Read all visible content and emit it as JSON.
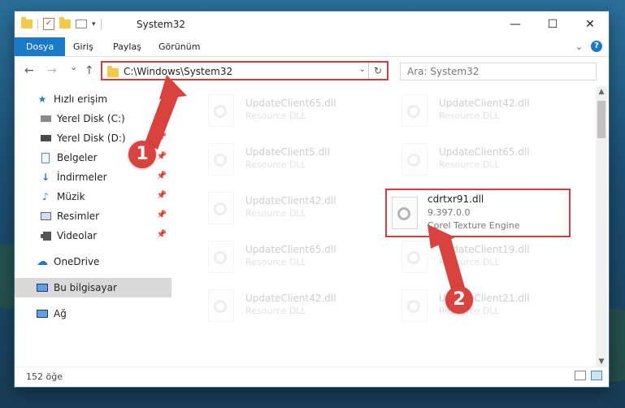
{
  "window": {
    "title": "System32",
    "controls": {
      "minimize": "—",
      "maximize": "☐",
      "close": "✕"
    }
  },
  "ribbon": {
    "tabs": [
      {
        "label": "Dosya",
        "active": true
      },
      {
        "label": "Giriş"
      },
      {
        "label": "Paylaş"
      },
      {
        "label": "Görünüm"
      }
    ],
    "expand_icon": "chevron-down-icon",
    "help_icon": "help-icon"
  },
  "nav": {
    "back": "←",
    "forward": "→",
    "recent": "⌄",
    "up": "↑",
    "address": "C:\\Windows\\System32",
    "search_placeholder": "Ara: System32"
  },
  "sidebar": {
    "items": [
      {
        "label": "Hızlı erişim",
        "icon": "star-icon"
      },
      {
        "label": "Yerel Disk (C:)",
        "icon": "drive-icon",
        "pinned": true
      },
      {
        "label": "Yerel Disk (D:)",
        "icon": "drive-icon",
        "pinned": true
      },
      {
        "label": "Belgeler",
        "icon": "document-icon",
        "pinned": true
      },
      {
        "label": "İndirmeler",
        "icon": "download-icon",
        "pinned": true
      },
      {
        "label": "Müzik",
        "icon": "music-icon",
        "pinned": true
      },
      {
        "label": "Resimler",
        "icon": "pictures-icon",
        "pinned": true
      },
      {
        "label": "Videolar",
        "icon": "video-icon",
        "pinned": true
      },
      {
        "label": "OneDrive",
        "icon": "cloud-icon"
      },
      {
        "label": "Bu bilgisayar",
        "icon": "computer-icon",
        "selected": true
      },
      {
        "label": "Ağ",
        "icon": "network-icon"
      }
    ]
  },
  "files": [
    {
      "name": "UpdateClient65.dll",
      "desc": "Resource DLL"
    },
    {
      "name": "UpdateClient42.dll",
      "desc": "Resource DLL"
    },
    {
      "name": "UpdateClient5.dll",
      "desc": "Resource DLL"
    },
    {
      "name": "UpdateClient65.dll",
      "desc": "Resource DLL"
    },
    {
      "name": "UpdateClient42.dll",
      "desc": "Resource DLL"
    },
    {
      "name": "cdrtxr91.dll",
      "version": "9.397.0.0",
      "desc": "Corel Texture Engine",
      "highlighted": true
    },
    {
      "name": "UpdateClient65.dll",
      "desc": "Resource DLL"
    },
    {
      "name": "UpdateClient19.dll",
      "desc": "Resource DLL"
    },
    {
      "name": "UpdateClient42.dll",
      "desc": "Resource DLL"
    },
    {
      "name": "UpdateClient21.dll",
      "desc": "Resource DLL"
    }
  ],
  "status": {
    "count": "152 öğe"
  },
  "callouts": [
    {
      "number": "1",
      "color": "#d9423d"
    },
    {
      "number": "2",
      "color": "#d9423d"
    }
  ]
}
